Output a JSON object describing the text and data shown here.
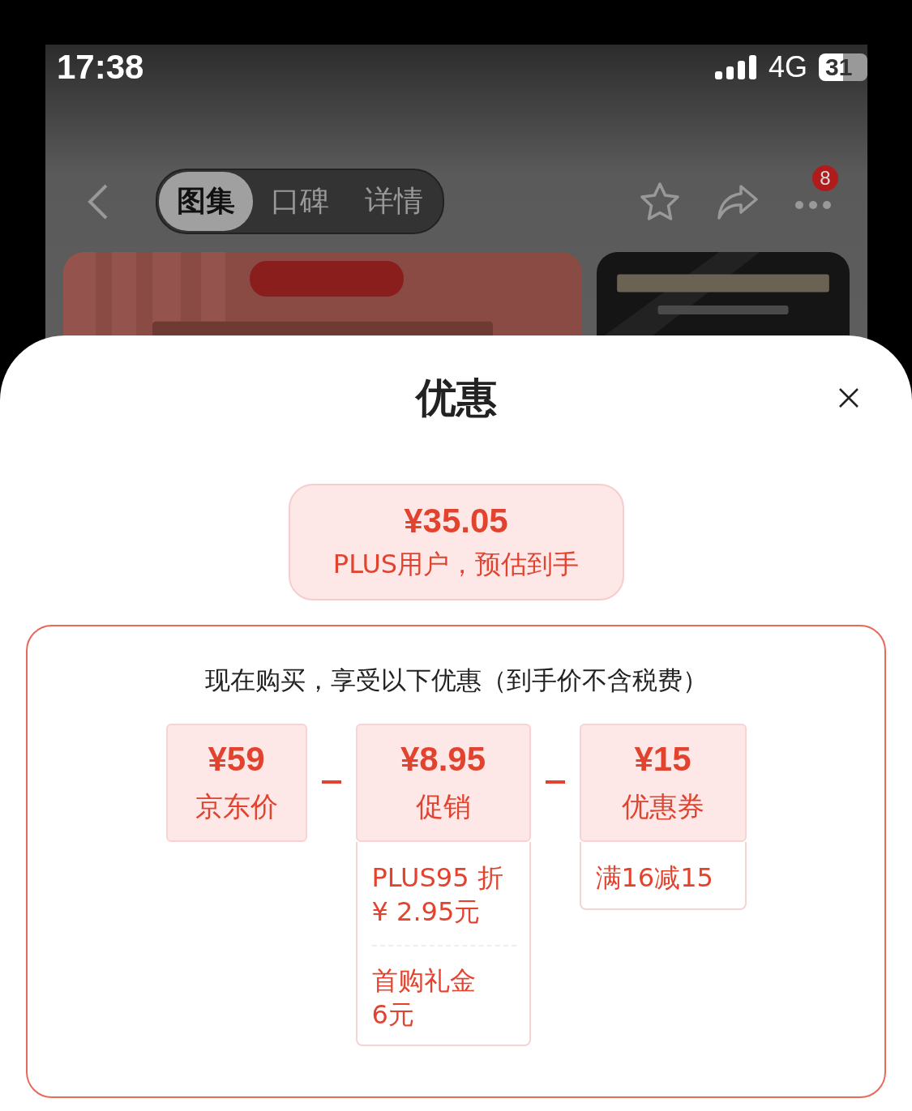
{
  "status_bar": {
    "time": "17:38",
    "network": "4G",
    "battery": "31"
  },
  "nav": {
    "tabs": [
      {
        "label": "图集",
        "selected": true
      },
      {
        "label": "口碑",
        "selected": false
      },
      {
        "label": "详情",
        "selected": false
      }
    ],
    "more_badge": "8"
  },
  "sheet": {
    "title": "优惠",
    "price": {
      "amount": "¥35.05",
      "caption": "PLUS用户，预估到手"
    },
    "subtitle": "现在购买，享受以下优惠（到手价不含税费）",
    "items": [
      {
        "amount": "¥59",
        "label": "京东价"
      },
      {
        "amount": "¥8.95",
        "label": "促销",
        "details": [
          "PLUS95 折\n¥ 2.95元",
          "首购礼金\n6元"
        ]
      },
      {
        "amount": "¥15",
        "label": "优惠券",
        "details": [
          "满16减15"
        ]
      }
    ]
  }
}
